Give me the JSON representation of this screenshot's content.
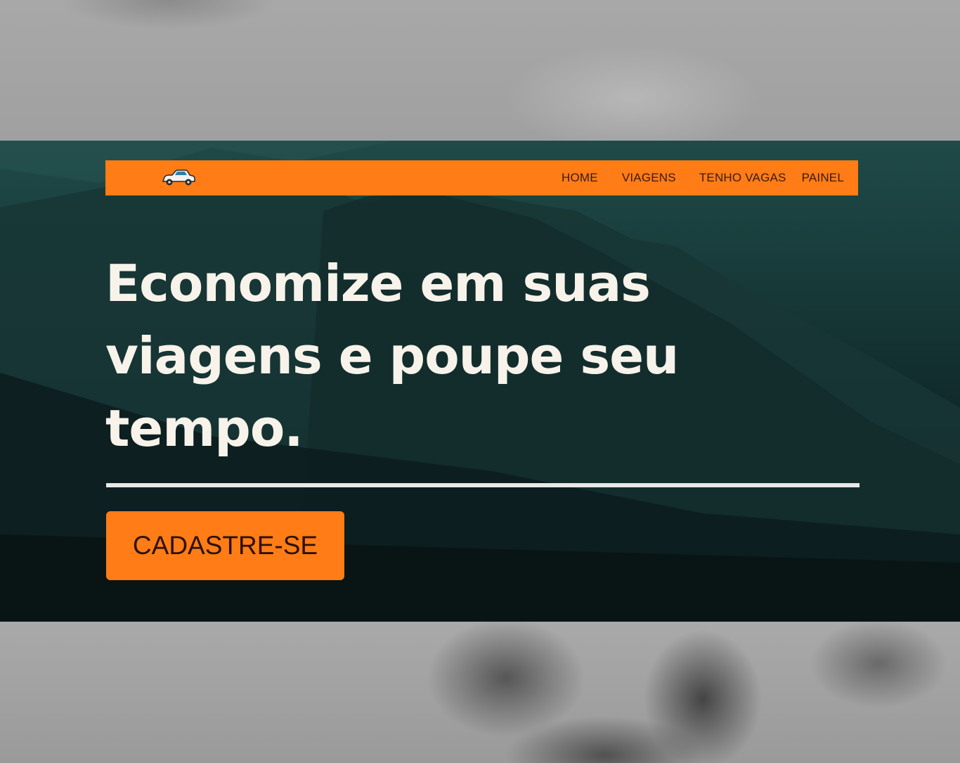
{
  "nav": {
    "logo_icon": "car-icon",
    "items": [
      {
        "label": "HOME"
      },
      {
        "label": "VIAGENS"
      },
      {
        "label": "TENHO VAGAS"
      },
      {
        "label": "PAINEL"
      }
    ]
  },
  "hero": {
    "headline": "Economize em suas viagens e poupe seu tempo.",
    "cta_label": "CADASTRE-SE"
  },
  "colors": {
    "accent": "#ff7c16",
    "hero_background": "#0f2728",
    "headline_text": "#f7f3ea"
  }
}
